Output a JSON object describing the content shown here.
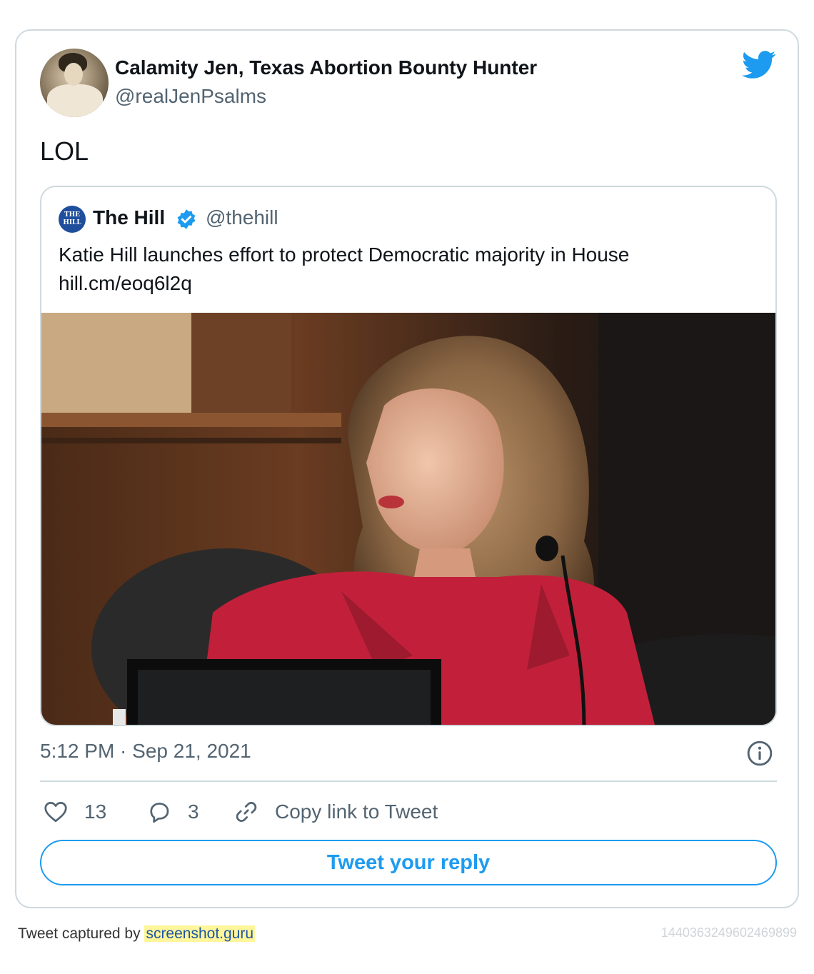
{
  "author": {
    "display_name": "Calamity Jen, Texas Abortion Bounty Hunter",
    "handle": "@realJenPsalms"
  },
  "tweet": {
    "text": "LOL",
    "timestamp": "5:12 PM · Sep 21, 2021"
  },
  "quoted_tweet": {
    "avatar_text": "THE HILL",
    "name": "The Hill",
    "handle": "@thehill",
    "text_line1": "Katie Hill launches effort to protect Democratic majority in House",
    "text_line2": "hill.cm/eoq6l2q"
  },
  "actions": {
    "likes": "13",
    "replies": "3",
    "copy_link_label": "Copy link to Tweet"
  },
  "reply_button_label": "Tweet your reply",
  "footer": {
    "prefix": "Tweet captured by ",
    "site": "screenshot.guru",
    "tweet_id": "1440363249602469899"
  },
  "icons": {
    "brand": "twitter-bird-icon",
    "verified": "verified-badge-icon",
    "info": "info-icon",
    "like": "heart-icon",
    "reply": "speech-bubble-icon",
    "copy": "link-icon"
  },
  "colors": {
    "accent": "#1d9bf0",
    "text": "#0f1419",
    "secondary": "#536471",
    "border": "#cfd9de",
    "footer_highlight": "#fff59a"
  }
}
